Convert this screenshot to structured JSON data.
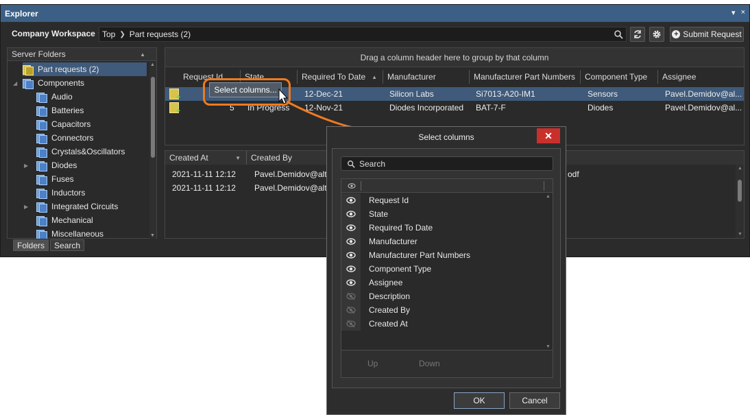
{
  "window": {
    "title": "Explorer",
    "pin": "▾",
    "close": "×"
  },
  "toolbar": {
    "workspace": "Company Workspace",
    "crumbs": [
      "Top",
      "Part requests (2)"
    ],
    "submit_label": "Submit Request"
  },
  "left_panel": {
    "header": "Server Folders",
    "items": [
      {
        "label": "Part requests (2)",
        "selected": true,
        "yellow": true
      },
      {
        "label": "Components",
        "expanded": true
      },
      {
        "label": "Audio"
      },
      {
        "label": "Batteries"
      },
      {
        "label": "Capacitors"
      },
      {
        "label": "Connectors"
      },
      {
        "label": "Crystals&Oscillators"
      },
      {
        "label": "Diodes",
        "expandable": true
      },
      {
        "label": "Fuses"
      },
      {
        "label": "Inductors"
      },
      {
        "label": "Integrated Circuits",
        "expandable": true
      },
      {
        "label": "Mechanical"
      },
      {
        "label": "Miscellaneous"
      }
    ],
    "tabs": [
      "Folders",
      "Search"
    ]
  },
  "grid": {
    "group_hint": "Drag a column header here to group by that column",
    "headers": [
      "Request Id",
      "State",
      "Required To Date",
      "Manufacturer",
      "Manufacturer Part Numbers",
      "Component Type",
      "Assignee"
    ],
    "rows": [
      {
        "request_id": "",
        "state": "",
        "required": "12-Dec-21",
        "manufacturer": "Silicon Labs",
        "mpn": "Si7013-A20-IM1",
        "type": "Sensors",
        "assignee": "Pavel.Demidov@al..."
      },
      {
        "request_id": "5",
        "state": "In Progress",
        "required": "12-Nov-21",
        "manufacturer": "Diodes Incorporated",
        "mpn": "BAT-7-F",
        "type": "Diodes",
        "assignee": "Pavel.Demidov@al..."
      }
    ]
  },
  "details": {
    "headers": [
      "Created At",
      "Created By"
    ],
    "rows": [
      {
        "created_at": "2021-11-11 12:12",
        "created_by": "Pavel.Demidov@alt...",
        "extra": "odf"
      },
      {
        "created_at": "2021-11-11 12:12",
        "created_by": "Pavel.Demidov@alt..."
      }
    ]
  },
  "context_menu": {
    "item": "Select columns..."
  },
  "dialog": {
    "title": "Select columns",
    "close": "✕",
    "search_placeholder": "Search",
    "columns": [
      {
        "label": "Request Id",
        "visible": true
      },
      {
        "label": "State",
        "visible": true
      },
      {
        "label": "Required To Date",
        "visible": true
      },
      {
        "label": "Manufacturer",
        "visible": true
      },
      {
        "label": "Manufacturer Part Numbers",
        "visible": true
      },
      {
        "label": "Component Type",
        "visible": true
      },
      {
        "label": "Assignee",
        "visible": true
      },
      {
        "label": "Description",
        "visible": false
      },
      {
        "label": "Created By",
        "visible": false
      },
      {
        "label": "Created At",
        "visible": false
      }
    ],
    "up_label": "Up",
    "down_label": "Down",
    "ok_label": "OK",
    "cancel_label": "Cancel"
  },
  "colors": {
    "accent": "#3c5f85",
    "highlight": "#f07a1f",
    "close_red": "#c9302c"
  }
}
